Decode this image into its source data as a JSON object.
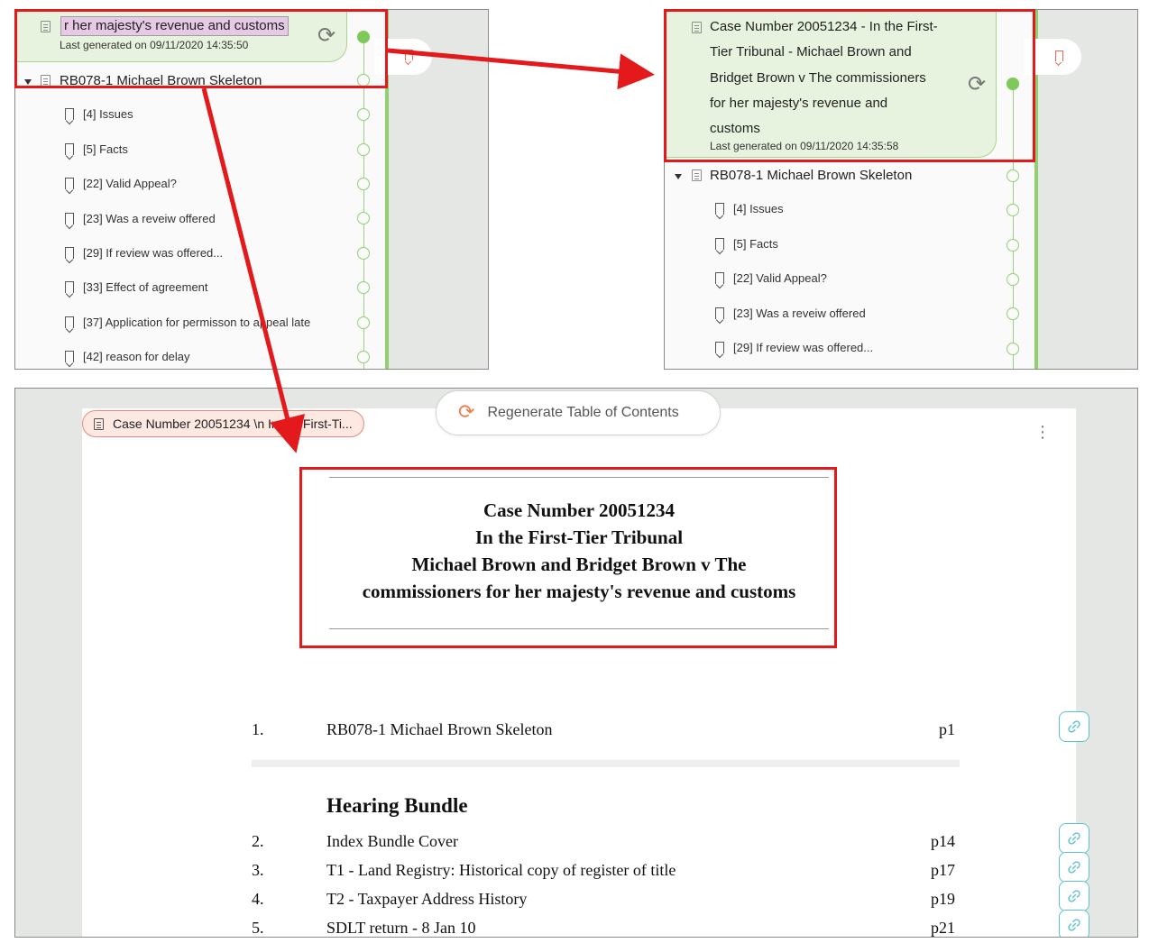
{
  "panel_a": {
    "title_fragment": "r her majesty's revenue and customs",
    "last_generated": "Last generated on 09/11/2020 14:35:50",
    "skeleton_label": "RB078-1 Michael Brown Skeleton",
    "items": [
      "[4] Issues",
      "[5] Facts",
      "[22] Valid Appeal?",
      "[23] Was a reveiw offered",
      "[29] If review was offered...",
      "[33] Effect of agreement",
      "[37] Application for permisson to appeal late",
      "[42] reason for delay"
    ]
  },
  "panel_b": {
    "title_lines": [
      "Case Number 20051234 - In the First-",
      "Tier Tribunal - Michael Brown and",
      "Bridget Brown v The commissioners",
      "for her majesty's revenue and",
      "customs"
    ],
    "last_generated": "Last generated on 09/11/2020 14:35:58",
    "skeleton_label": "RB078-1 Michael Brown Skeleton",
    "items": [
      "[4] Issues",
      "[5] Facts",
      "[22] Valid Appeal?",
      "[23] Was a reveiw offered",
      "[29] If review was offered..."
    ]
  },
  "panel_c": {
    "breadcrumb": "Case Number 20051234 \\n In the First-Ti...",
    "regenerate_label": "Regenerate Table of Contents",
    "kebab": "⋮",
    "doc_title_lines": [
      "Case Number 20051234",
      "In the First-Tier Tribunal",
      "Michael Brown and Bridget Brown v The",
      "commissioners for her majesty's revenue and customs"
    ],
    "first_entry": {
      "num": "1.",
      "text": "RB078-1 Michael Brown Skeleton",
      "page": "p1"
    },
    "section_heading": "Hearing Bundle",
    "entries": [
      {
        "num": "2.",
        "text": "Index Bundle Cover",
        "page": "p14"
      },
      {
        "num": "3.",
        "text": "T1 - Land Registry: Historical copy of register of title",
        "page": "p17"
      },
      {
        "num": "4.",
        "text": "T2 - Taxpayer Address History",
        "page": "p19"
      },
      {
        "num": "5.",
        "text": "SDLT return - 8 Jan 10",
        "page": "p21"
      }
    ]
  },
  "icons": {
    "refresh": "⟳",
    "document": "document-icon",
    "bookmark": "bookmark-icon",
    "link": "link-icon"
  },
  "colors": {
    "highlight_red": "#e4191b",
    "timeline_green": "#8fd170",
    "header_green": "#e7f3df",
    "selection_purple": "#e6c9e4",
    "accent_orange": "#ef7c4d",
    "link_teal": "#5cc3cb"
  }
}
